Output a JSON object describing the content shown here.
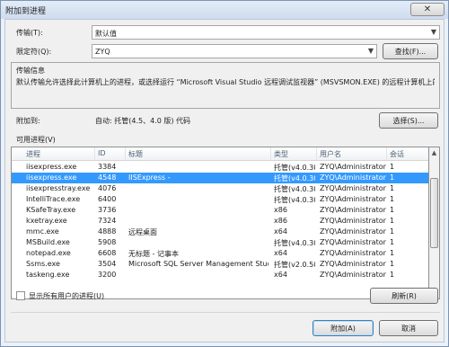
{
  "window": {
    "title": "附加到进程",
    "close_icon": "close-icon"
  },
  "transport": {
    "label": "传输(T):",
    "value": "默认值"
  },
  "qualifier": {
    "label": "限定符(Q):",
    "value": "ZYQ",
    "find_button": "查找(F)..."
  },
  "info": {
    "header": "传输信息",
    "text": "默认传输允许选择此计算机上的进程，或选择运行 “Microsoft Visual Studio 远程调试监视器” (MSVSMON.EXE) 的远程计算机上的进程。"
  },
  "attach": {
    "label": "附加到:",
    "value": "自动: 托管(4.5、4.0 版) 代码",
    "select_button": "选择(S)..."
  },
  "processes": {
    "label": "可用进程(V)",
    "columns": [
      "进程",
      "ID",
      "标题",
      "类型",
      "用户名",
      "会话"
    ],
    "rows": [
      {
        "name": "iisexpress.exe",
        "id": "3384",
        "title": "",
        "type": "托管(v4.0.30...",
        "user": "ZYQ\\Administrator...",
        "session": "1",
        "selected": false
      },
      {
        "name": "iisexpress.exe",
        "id": "4548",
        "title": "IISExpress -",
        "type": "托管(v4.0.30...",
        "user": "ZYQ\\Administrator...",
        "session": "1",
        "selected": true
      },
      {
        "name": "iisexpresstray.exe",
        "id": "4076",
        "title": "",
        "type": "托管(v4.0.30...",
        "user": "ZYQ\\Administrator...",
        "session": "1",
        "selected": false
      },
      {
        "name": "IntelliTrace.exe",
        "id": "6400",
        "title": "",
        "type": "托管(v4.0.30...",
        "user": "ZYQ\\Administrator...",
        "session": "1",
        "selected": false
      },
      {
        "name": "KSafeTray.exe",
        "id": "3736",
        "title": "",
        "type": "x86",
        "user": "ZYQ\\Administrator...",
        "session": "1",
        "selected": false
      },
      {
        "name": "kxetray.exe",
        "id": "7324",
        "title": "",
        "type": "x86",
        "user": "ZYQ\\Administrator...",
        "session": "1",
        "selected": false
      },
      {
        "name": "mmc.exe",
        "id": "4888",
        "title": "远程桌面",
        "type": "x64",
        "user": "ZYQ\\Administrator...",
        "session": "1",
        "selected": false
      },
      {
        "name": "MSBuild.exe",
        "id": "5908",
        "title": "",
        "type": "托管(v4.0.30...",
        "user": "ZYQ\\Administrator...",
        "session": "1",
        "selected": false
      },
      {
        "name": "notepad.exe",
        "id": "6608",
        "title": "无标题 - 记事本",
        "type": "x64",
        "user": "ZYQ\\Administrator...",
        "session": "1",
        "selected": false
      },
      {
        "name": "Ssms.exe",
        "id": "3504",
        "title": "Microsoft SQL Server Management Studio",
        "type": "托管(v2.0.50...",
        "user": "ZYQ\\Administrator...",
        "session": "1",
        "selected": false
      },
      {
        "name": "taskeng.exe",
        "id": "3200",
        "title": "",
        "type": "x64",
        "user": "ZYQ\\Administrator...",
        "session": "1",
        "selected": false
      }
    ]
  },
  "show_all": {
    "label": "显示所有用户的进程(U)"
  },
  "refresh_button": "刷新(R)",
  "attach_button": "附加(A)",
  "cancel_button": "取消"
}
